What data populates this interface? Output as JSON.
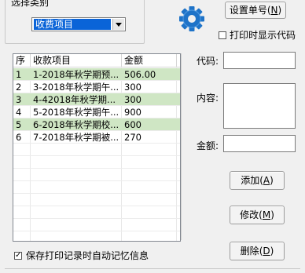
{
  "category_group": {
    "legend": "选择类别",
    "selected": "收费项目"
  },
  "buttons": {
    "set_number": "设置单号",
    "set_number_key": "N",
    "add": "添加",
    "add_key": "A",
    "modify": "修改",
    "modify_key": "M",
    "delete": "删除",
    "delete_key": "D"
  },
  "options": {
    "show_code_label": "打印时显示代码",
    "show_code_checked": false,
    "save_record_label": "保存打印记录时自动记忆信息",
    "save_record_checked": true
  },
  "table": {
    "headers": [
      "序",
      "收款项目",
      "金额"
    ],
    "rows": [
      {
        "no": "1",
        "item": "1-2018年秋学期预...",
        "amount": "506.00",
        "highlight": true
      },
      {
        "no": "2",
        "item": "3-2018年秋学期午...",
        "amount": "300",
        "highlight": false
      },
      {
        "no": "3",
        "item": "4-42018年秋学期...",
        "amount": "300",
        "highlight": true
      },
      {
        "no": "4",
        "item": "5-2018年秋学期午...",
        "amount": "900",
        "highlight": false
      },
      {
        "no": "5",
        "item": "6-2018年秋学期校...",
        "amount": "600",
        "highlight": true
      },
      {
        "no": "6",
        "item": "7-2018年秋学期被...",
        "amount": "270",
        "highlight": false
      }
    ]
  },
  "form": {
    "code_label": "代码:",
    "content_label": "内容:",
    "amount_label": "金额:",
    "code_value": "",
    "content_value": "",
    "amount_value": ""
  },
  "colors": {
    "row_highlight": "#cfe6c4",
    "selection": "#0a64d8",
    "gear": "#1e73c8"
  },
  "icons": {
    "gear": "gear-icon"
  }
}
